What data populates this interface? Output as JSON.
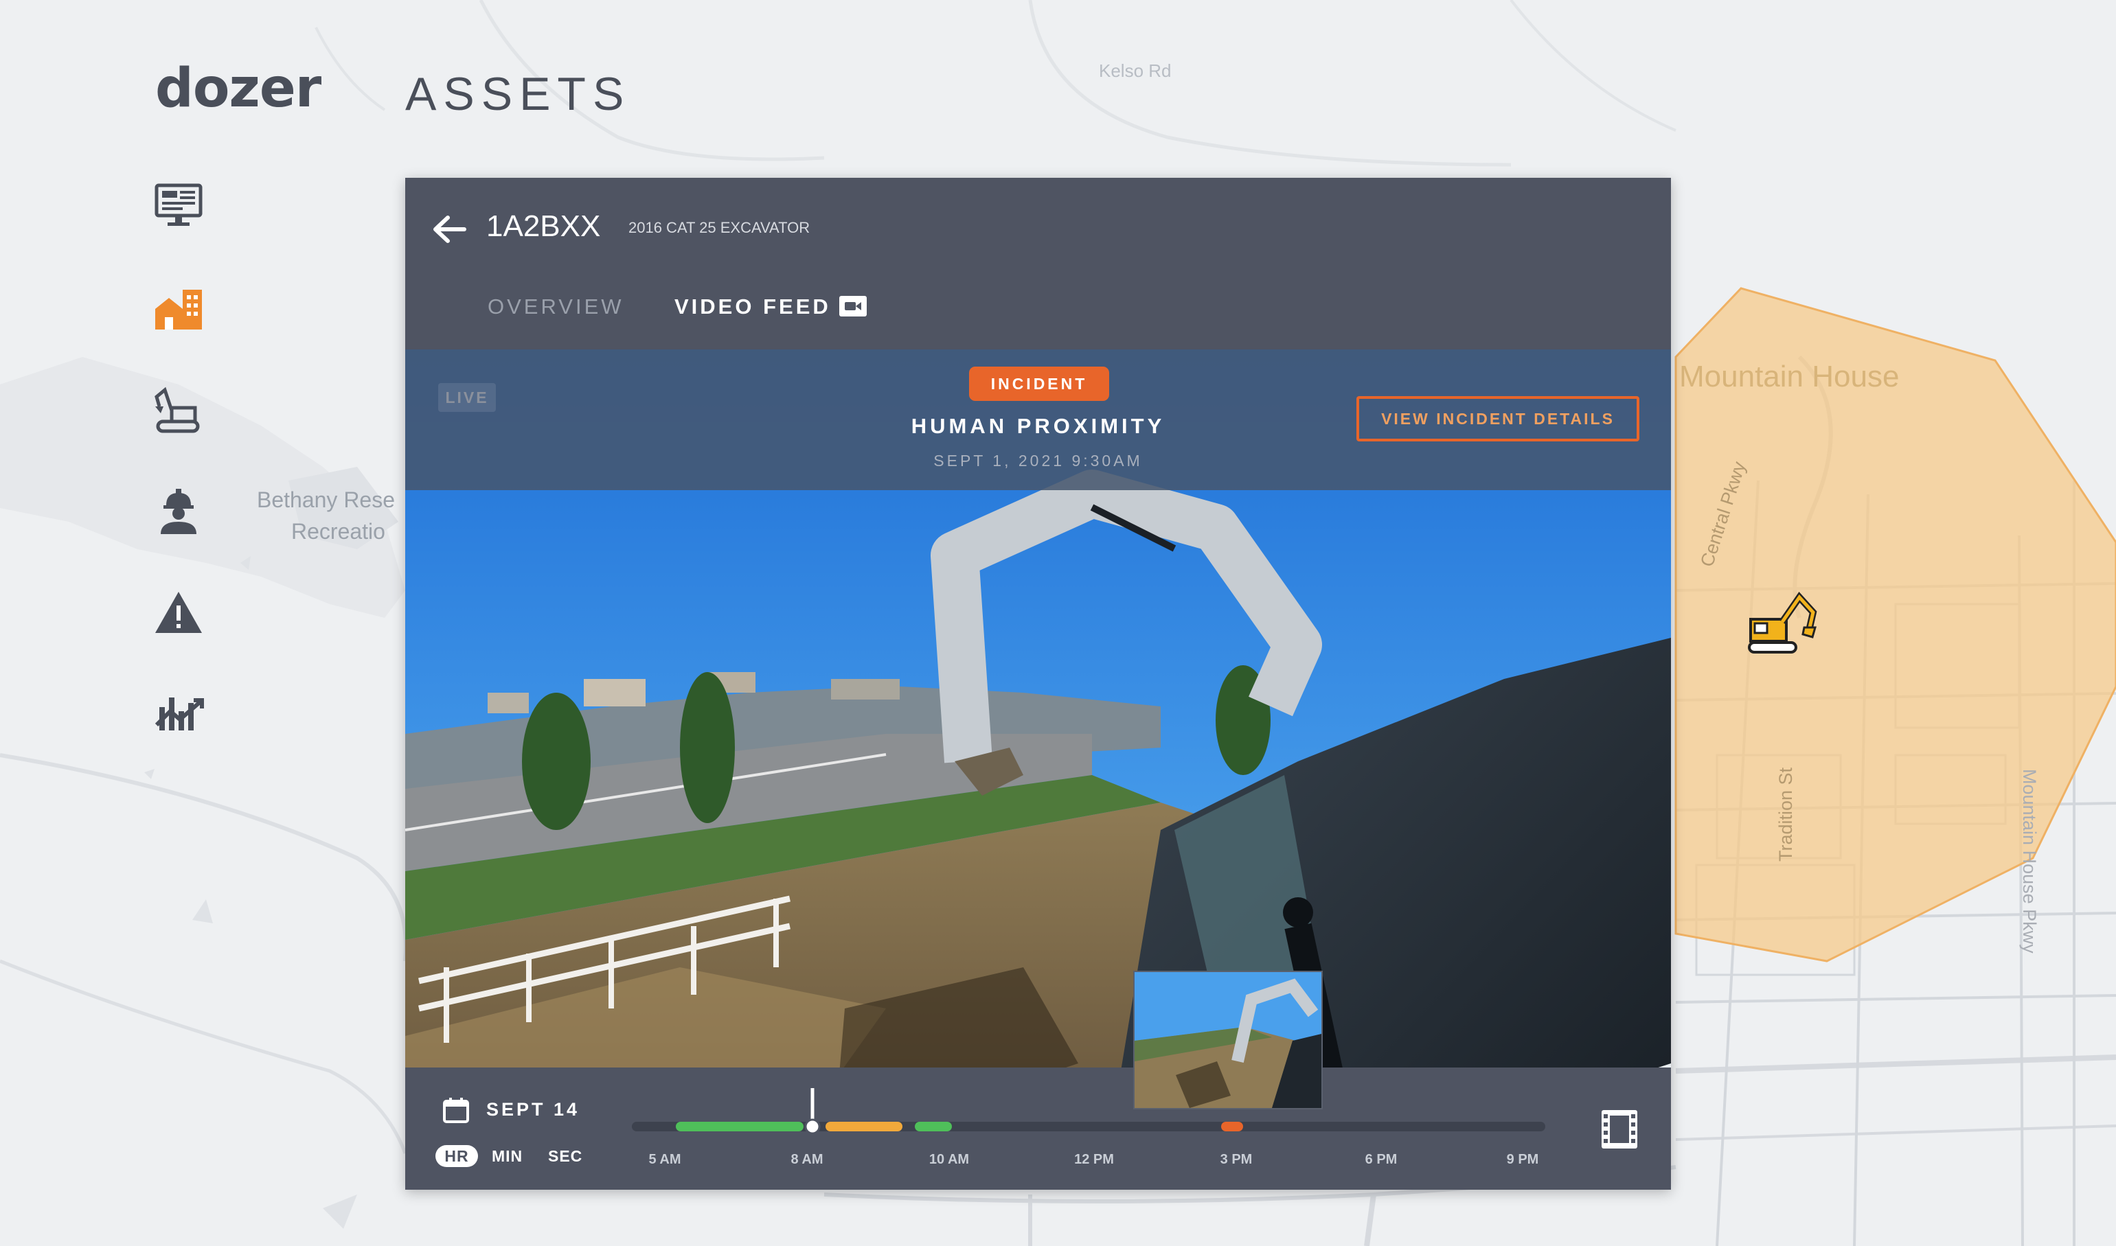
{
  "app": {
    "brand": "dozer",
    "page_title": "ASSETS"
  },
  "sidebar": {
    "items": [
      {
        "name": "dashboard",
        "icon": "monitor-icon",
        "active": false
      },
      {
        "name": "sites",
        "icon": "site-building-icon",
        "active": true
      },
      {
        "name": "assets",
        "icon": "excavator-icon",
        "active": false
      },
      {
        "name": "workers",
        "icon": "worker-icon",
        "active": false
      },
      {
        "name": "incidents",
        "icon": "warning-icon",
        "active": false
      },
      {
        "name": "analytics",
        "icon": "analytics-chart-icon",
        "active": false
      }
    ]
  },
  "map": {
    "labels": {
      "road_top": "Kelso Rd",
      "bethany_line1": "Bethany Rese",
      "bethany_line2": "Recreatio",
      "mountain_house": "Mountain House",
      "central_pkwy": "Central Pkwy",
      "tradition_st": "Tradition St",
      "mountain_house_pkwy": "Mountain House Pkwy"
    },
    "geofence_color": "#f7c987",
    "marker_icon": "excavator-marker-icon"
  },
  "panel": {
    "asset_id": "1A2BXX",
    "asset_description": "2016 CAT 25 EXCAVATOR",
    "tabs": [
      {
        "label": "OVERVIEW",
        "active": false
      },
      {
        "label": "VIDEO FEED",
        "active": true
      }
    ],
    "incident": {
      "live_label": "LIVE",
      "badge": "INCIDENT",
      "title": "HUMAN PROXIMITY",
      "datetime": "SEPT 1, 2021 9:30AM",
      "details_button": "VIEW INCIDENT DETAILS"
    },
    "playback": {
      "date": "SEPT 14",
      "units": [
        "HR",
        "MIN",
        "SEC"
      ],
      "selected_unit": "HR",
      "ticks": [
        "5 AM",
        "8 AM",
        "10 AM",
        "12 PM",
        "3 PM",
        "6 PM",
        "9 PM"
      ]
    }
  },
  "colors": {
    "accent": "#e8652a",
    "panel_bg": "#4f5462",
    "timeline_green": "#4fbf5a",
    "timeline_yellow": "#f2a93b",
    "timeline_red": "#e8652a"
  }
}
